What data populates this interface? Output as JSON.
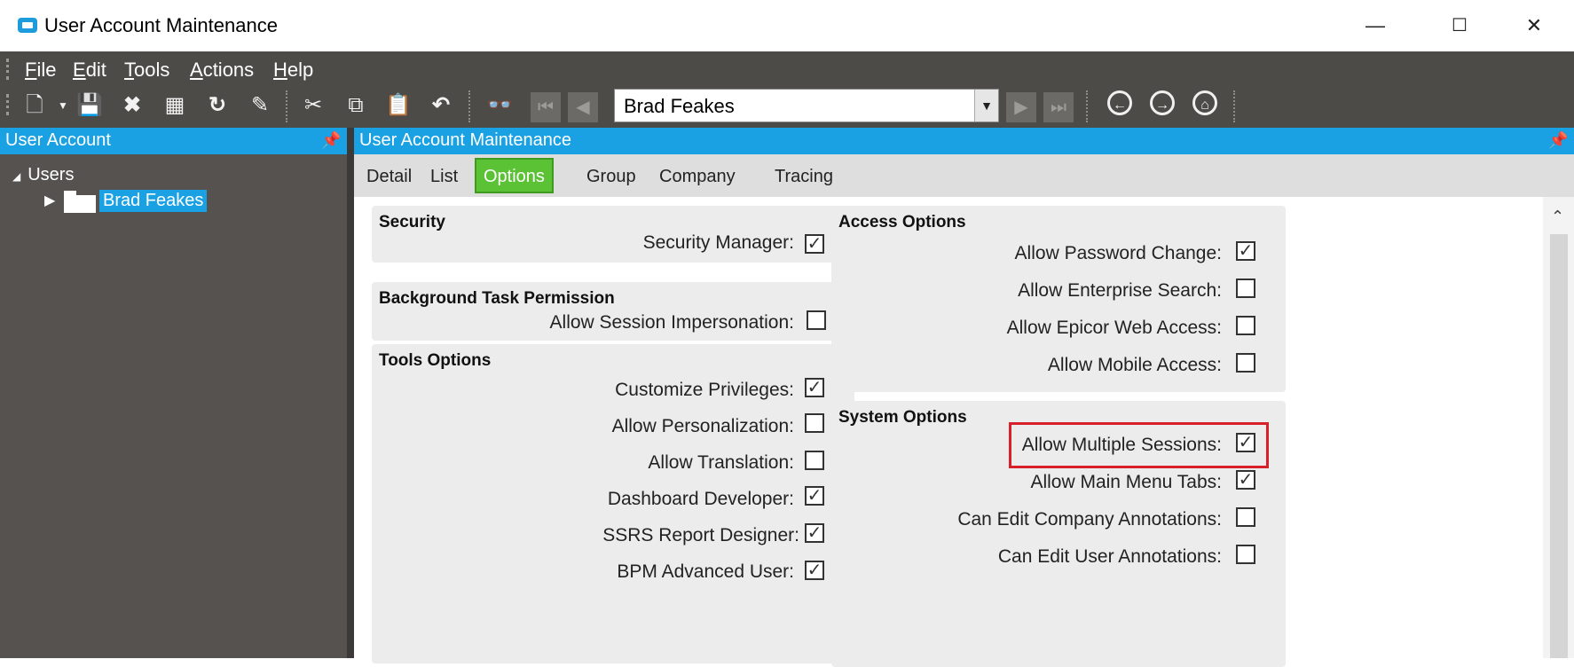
{
  "window": {
    "title": "User Account Maintenance",
    "minimize": "—",
    "maximize": "☐",
    "close": "✕"
  },
  "menu": [
    {
      "first": "F",
      "rest": "ile"
    },
    {
      "first": "E",
      "rest": "dit"
    },
    {
      "first": "T",
      "rest": "ools"
    },
    {
      "first": "A",
      "rest": "ctions"
    },
    {
      "first": "H",
      "rest": "elp"
    }
  ],
  "toolbar": {
    "selected_user": "Brad Feakes",
    "icons": [
      "new-icon",
      "save-icon",
      "delete-icon",
      "clear-icon",
      "refresh-icon",
      "paint-icon",
      "cut-icon",
      "copy-icon",
      "paste-icon",
      "undo-icon",
      "search-icon"
    ]
  },
  "left_pane": {
    "title": "User Account",
    "tree_root": "Users",
    "tree_child": "Brad Feakes"
  },
  "right_pane": {
    "title": "User Account Maintenance",
    "tabs": [
      "Detail",
      "List",
      "Options",
      "Group",
      "Company",
      "Tracing"
    ],
    "active_tab": "Options"
  },
  "groups": {
    "security": {
      "title": "Security",
      "options": [
        {
          "label": "Security Manager:",
          "checked": true
        }
      ]
    },
    "background": {
      "title": "Background Task Permission",
      "options": [
        {
          "label": "Allow Session Impersonation:",
          "checked": false
        }
      ]
    },
    "tools": {
      "title": "Tools Options",
      "options": [
        {
          "label": "Customize Privileges:",
          "checked": true
        },
        {
          "label": "Allow Personalization:",
          "checked": false
        },
        {
          "label": "Allow Translation:",
          "checked": false
        },
        {
          "label": "Dashboard Developer:",
          "checked": true
        },
        {
          "label": "SSRS Report Designer:",
          "checked": true
        },
        {
          "label": "BPM Advanced User:",
          "checked": true
        }
      ]
    },
    "access": {
      "title": "Access Options",
      "options": [
        {
          "label": "Allow Password Change:",
          "checked": true
        },
        {
          "label": "Allow Enterprise Search:",
          "checked": false
        },
        {
          "label": "Allow Epicor Web Access:",
          "checked": false
        },
        {
          "label": "Allow Mobile Access:",
          "checked": false
        }
      ]
    },
    "system": {
      "title": "System Options",
      "options": [
        {
          "label": "Allow Multiple Sessions:",
          "checked": true
        },
        {
          "label": "Allow Main Menu Tabs:",
          "checked": true
        },
        {
          "label": "Can Edit Company Annotations:",
          "checked": false
        },
        {
          "label": "Can Edit User Annotations:",
          "checked": false
        }
      ]
    }
  },
  "colors": {
    "accent": "#1aa1e3",
    "active_tab": "#5bc236",
    "highlight": "#d8202b",
    "chrome": "#4d4b48"
  }
}
